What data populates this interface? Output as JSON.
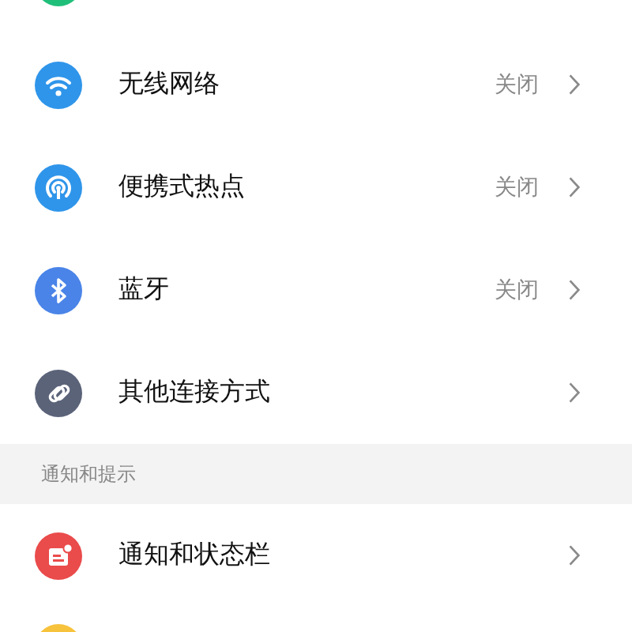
{
  "items": [
    {
      "kind": "clipped",
      "color": "#1fbf7a"
    },
    {
      "kind": "row",
      "label": "无线网络",
      "status": "关闭"
    },
    {
      "kind": "row",
      "label": "便携式热点",
      "status": "关闭"
    },
    {
      "kind": "row",
      "label": "蓝牙",
      "status": "关闭"
    },
    {
      "kind": "row",
      "label": "其他连接方式"
    },
    {
      "kind": "header",
      "label": "通知和提示"
    },
    {
      "kind": "row",
      "label": "通知和状态栏"
    },
    {
      "kind": "clipped-bottom",
      "color": "#f7c23c"
    }
  ]
}
